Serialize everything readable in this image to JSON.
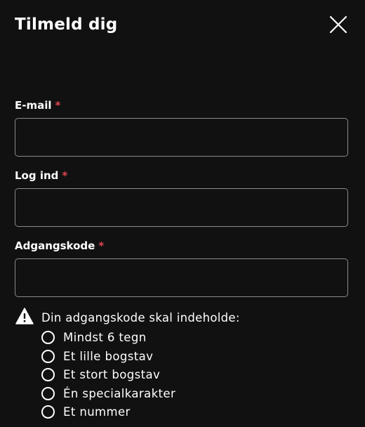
{
  "dialog": {
    "title": "Tilmeld dig",
    "close_icon": "close-icon"
  },
  "fields": {
    "email": {
      "label": "E-mail",
      "required_mark": "*",
      "value": "",
      "placeholder": ""
    },
    "login": {
      "label": "Log ind",
      "required_mark": "*",
      "value": "",
      "placeholder": ""
    },
    "password": {
      "label": "Adgangskode",
      "required_mark": "*",
      "value": "",
      "placeholder": ""
    }
  },
  "password_rules": {
    "heading": "Din adgangskode skal indeholde:",
    "heading_icon": "warning-icon",
    "items": [
      {
        "text": "Mindst 6 tegn",
        "met": false
      },
      {
        "text": "Et lille bogstav",
        "met": false
      },
      {
        "text": "Et stort bogstav",
        "met": false
      },
      {
        "text": "Én specialkarakter",
        "met": false
      },
      {
        "text": "Et nummer",
        "met": false
      }
    ]
  },
  "colors": {
    "background": "#111111",
    "text": "#ffffff",
    "required": "#e0464e",
    "input_border": "#8a8a8a"
  }
}
